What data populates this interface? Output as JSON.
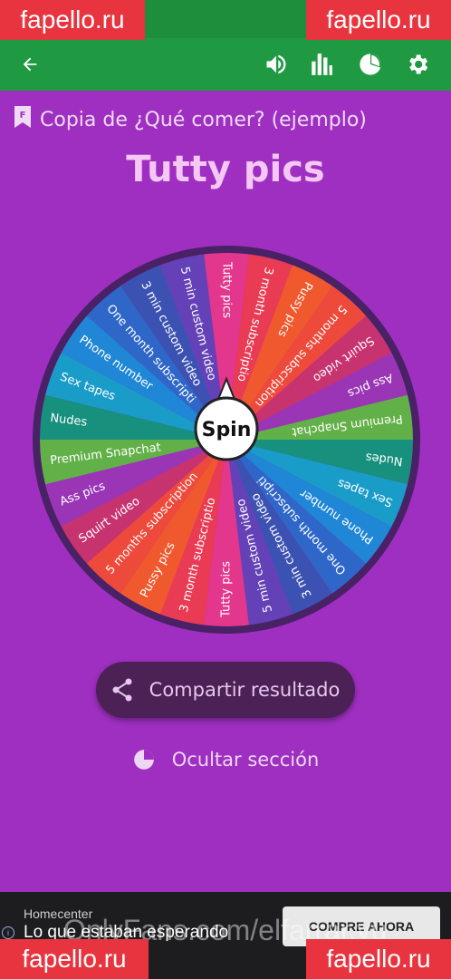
{
  "watermark": {
    "text": "fapello.ru",
    "color": "#e8343f"
  },
  "app_bar": {
    "color": "#1f9a42",
    "icons": [
      "back-arrow-icon",
      "volume-icon",
      "stats-icon",
      "pie-chart-icon",
      "gear-icon"
    ]
  },
  "page": {
    "subtitle": "Copia de ¿Qué comer? (ejemplo)",
    "title": "Tutty pics",
    "background": "#9e2fc0"
  },
  "wheel": {
    "center_label": "Spin",
    "segments": [
      {
        "label": "Tutty pics",
        "color": "#e2378c"
      },
      {
        "label": "3 month subscriptio",
        "color": "#e93b53"
      },
      {
        "label": "Pussy pics",
        "color": "#f0582e"
      },
      {
        "label": "5 months subscription",
        "color": "#ee4a3b"
      },
      {
        "label": "Squirt video",
        "color": "#c7336e"
      },
      {
        "label": "Ass pics",
        "color": "#9a36b5"
      },
      {
        "label": "Premium Snapchat",
        "color": "#62b148"
      },
      {
        "label": "Nudes",
        "color": "#17907d"
      },
      {
        "label": "Sex tapes",
        "color": "#1a9cc8"
      },
      {
        "label": "Phone number",
        "color": "#1f87d6"
      },
      {
        "label": "One month subscripti",
        "color": "#2f67c9"
      },
      {
        "label": "3 min custom video",
        "color": "#3c52b3"
      },
      {
        "label": "5 min custom video",
        "color": "#6441b6"
      },
      {
        "label": "Tutty pics",
        "color": "#e2378c"
      },
      {
        "label": "3 month subscriptio",
        "color": "#e93b53"
      },
      {
        "label": "Pussy pics",
        "color": "#f0582e"
      },
      {
        "label": "5 months subscription",
        "color": "#ee4a3b"
      },
      {
        "label": "Squirt video",
        "color": "#c7336e"
      },
      {
        "label": "Ass pics",
        "color": "#9a36b5"
      },
      {
        "label": "Premium Snapchat",
        "color": "#62b148"
      },
      {
        "label": "Nudes",
        "color": "#17907d"
      },
      {
        "label": "Sex tapes",
        "color": "#1a9cc8"
      },
      {
        "label": "Phone number",
        "color": "#1f87d6"
      },
      {
        "label": "One month subscripti",
        "color": "#2f67c9"
      },
      {
        "label": "3 min custom video",
        "color": "#3c52b3"
      },
      {
        "label": "5 min custom video",
        "color": "#6441b6"
      }
    ]
  },
  "actions": {
    "share_label": "Compartir resultado",
    "hide_label": "Ocultar sección"
  },
  "ad": {
    "brand": "Homecenter",
    "text": "Lo que estaban esperando",
    "cta": "COMPRE AHORA",
    "info": "i"
  },
  "overlay_watermark": "OnlyFans.com/elfarrar.yu"
}
